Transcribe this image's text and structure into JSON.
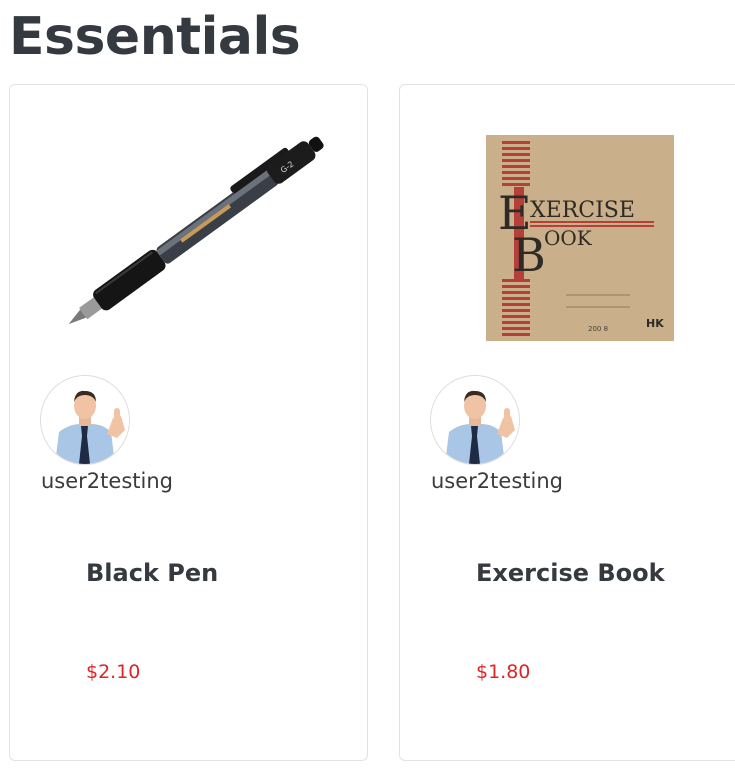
{
  "section": {
    "title": "Essentials"
  },
  "products": [
    {
      "name": "Black Pen",
      "price": "$2.10",
      "seller": "user2testing",
      "image_icon": "black-pen-image"
    },
    {
      "name": "Exercise Book",
      "price": "$1.80",
      "seller": "user2testing",
      "image_icon": "exercise-book-image",
      "cover_text": [
        "E",
        "XERCISE",
        "B",
        "OOK",
        "200 8",
        "HK"
      ]
    }
  ],
  "colors": {
    "price": "#dc2626",
    "heading": "#343a40",
    "card_border": "#e2e2e2"
  }
}
